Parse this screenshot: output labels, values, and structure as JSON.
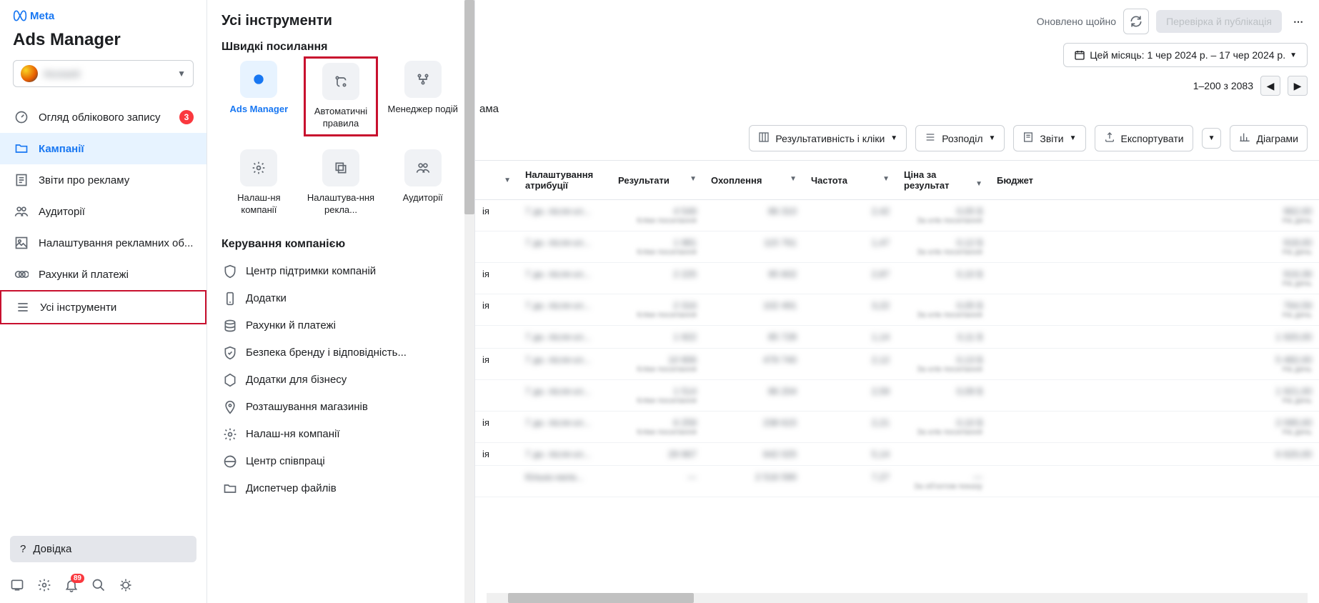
{
  "brand": {
    "meta": "Meta",
    "app": "Ads Manager"
  },
  "account": {
    "name": "Account"
  },
  "nav": {
    "overview": "Огляд облікового запису",
    "overview_badge": "3",
    "campaigns": "Кампанії",
    "ad_reports": "Звіти про рекламу",
    "audiences": "Аудиторії",
    "ad_settings": "Налаштування рекламних об...",
    "billing": "Рахунки й платежі",
    "all_tools": "Усі інструменти"
  },
  "help": {
    "label": "Довідка"
  },
  "footer": {
    "notif": "89"
  },
  "tools": {
    "title": "Усі інструменти",
    "quick_label": "Швидкі посилання",
    "quick": {
      "ads_manager": "Ads Manager",
      "auto_rules": "Автоматичні правила",
      "events_mgr": "Менеджер подій",
      "company_settings": "Налаш-ня компанії",
      "ad_settings": "Налаштува-ння рекла...",
      "audiences": "Аудиторії"
    },
    "mgmt_label": "Керування компанією",
    "mgmt": {
      "support": "Центр підтримки компаній",
      "apps": "Додатки",
      "billing": "Рахунки й платежі",
      "brand_safety": "Безпека бренду і відповідність...",
      "biz_apps": "Додатки для бізнесу",
      "store_loc": "Розташування магазинів",
      "company_settings": "Налаш-ня компанії",
      "collab": "Центр співпраці",
      "file_mgr": "Диспетчер файлів"
    }
  },
  "topbar": {
    "updated": "Оновлено щойно",
    "publish": "Перевірка й публікація"
  },
  "daterange": "Цей місяць: 1 чер 2024 р. – 17 чер 2024 р.",
  "pager": "1–200 з 2083",
  "tab_ad": "ама",
  "toolbar": {
    "perf": "Результативність і кліки",
    "distribution": "Розподіл",
    "reports": "Звіти",
    "export": "Експортувати",
    "charts": "Діаграми"
  },
  "table": {
    "headers": {
      "attribution": "Налаштування атрибуції",
      "results": "Результати",
      "reach": "Охоплення",
      "frequency": "Частота",
      "cost": "Ціна за результат",
      "budget": "Бюджет"
    },
    "rows": [
      {
        "id": "ія",
        "attr": "7 дн. після кл...",
        "r": "4 549",
        "subr": "Кліки посилання",
        "reach": "86 310",
        "freq": "2,42",
        "cost": "0,05 $",
        "subcost": "За клік посилання",
        "budget": "962,00",
        "subb": "На день"
      },
      {
        "id": "",
        "attr": "7 дн. після кл...",
        "r": "1 981",
        "subr": "Кліки посилання",
        "reach": "115 761",
        "freq": "1,47",
        "cost": "0,12 $",
        "subcost": "За клік посилання",
        "budget": "918,00",
        "subb": "На день"
      },
      {
        "id": "ія",
        "attr": "7 дн. після кл...",
        "r": "2 225",
        "subr": "",
        "reach": "95 602",
        "freq": "2,87",
        "cost": "0,10 $",
        "subcost": "",
        "budget": "919,39",
        "subb": "На день"
      },
      {
        "id": "ія",
        "attr": "7 дн. після кл...",
        "r": "2 316",
        "subr": "Кліки посилання",
        "reach": "102 491",
        "freq": "3,22",
        "cost": "0,05 $",
        "subcost": "За клік посилання",
        "budget": "764,59",
        "subb": "На день"
      },
      {
        "id": "",
        "attr": "7 дн. після кл...",
        "r": "1 922",
        "subr": "",
        "reach": "85 728",
        "freq": "1,14",
        "cost": "0,11 $",
        "subcost": "",
        "budget": "1 920,00",
        "subb": ""
      },
      {
        "id": "ія",
        "attr": "7 дн. після кл...",
        "r": "10 906",
        "subr": "Кліки посилання",
        "reach": "479 740",
        "freq": "2,12",
        "cost": "0,13 $",
        "subcost": "За клік посилання",
        "budget": "5 482,00",
        "subb": "На день"
      },
      {
        "id": "",
        "attr": "7 дн. після кл...",
        "r": "1 514",
        "subr": "Кліки посилання",
        "reach": "86 204",
        "freq": "2,59",
        "cost": "0,09 $",
        "subcost": "",
        "budget": "1 921,00",
        "subb": "На день"
      },
      {
        "id": "ія",
        "attr": "7 дн. після кл...",
        "r": "6 259",
        "subr": "Кліки посилання",
        "reach": "238 615",
        "freq": "2,21",
        "cost": "0,10 $",
        "subcost": "За клік посилання",
        "budget": "2 095,00",
        "subb": "На день"
      },
      {
        "id": "ія",
        "attr": "7 дн. після кл...",
        "r": "29 967",
        "subr": "",
        "reach": "642 025",
        "freq": "5,14",
        "cost": "",
        "subcost": "",
        "budget": "6 620,00",
        "subb": ""
      },
      {
        "id": "",
        "attr": "Кілька нала...",
        "r": "—",
        "subr": "",
        "reach": "2 516 590",
        "freq": "7,27",
        "cost": "—",
        "subcost": "За об'єктом показу",
        "budget": "",
        "subb": ""
      }
    ]
  }
}
